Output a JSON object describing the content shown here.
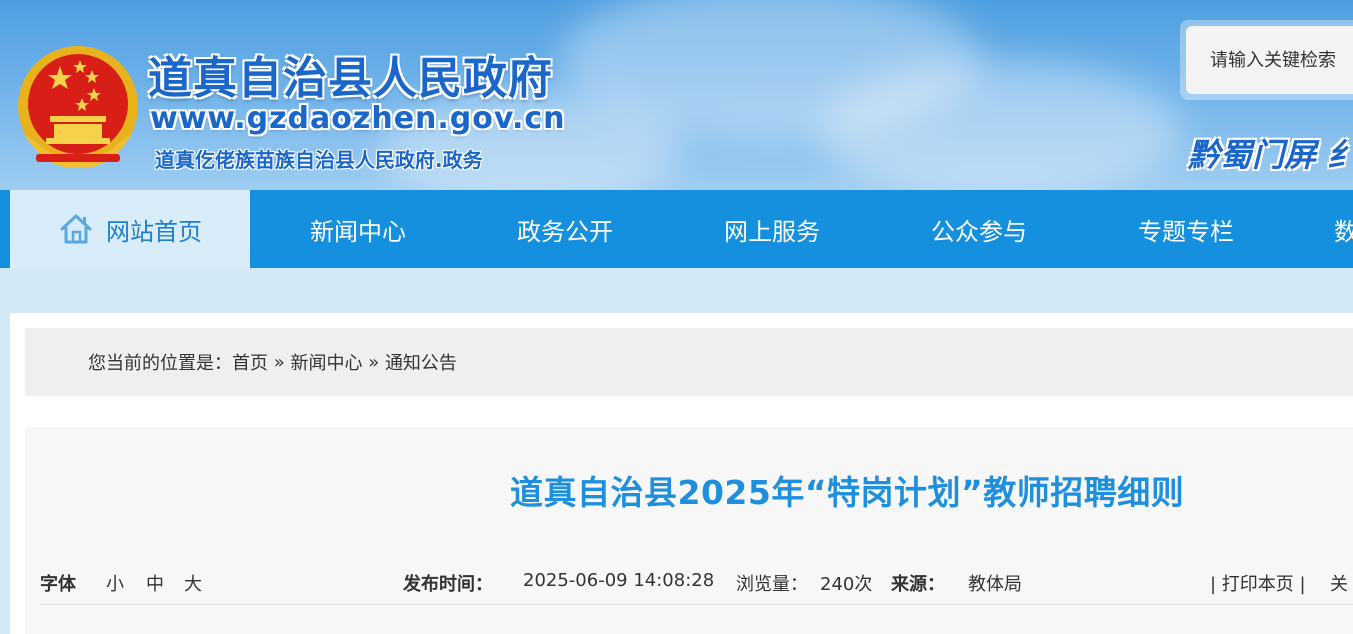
{
  "header": {
    "site_title": "道真自治县人民政府",
    "site_url": "www.gzdaozhen.gov.cn",
    "site_subtitle": "道真仡佬族苗族自治县人民政府.政务",
    "search_placeholder": "请输入关键检索",
    "portal_link": "黔蜀门屏 纟",
    "emblem": "national-emblem-icon"
  },
  "nav": {
    "items": [
      {
        "label": "网站首页",
        "active": true
      },
      {
        "label": "新闻中心"
      },
      {
        "label": "政务公开"
      },
      {
        "label": "网上服务"
      },
      {
        "label": "公众参与"
      },
      {
        "label": "专题专栏"
      },
      {
        "label": "数"
      }
    ]
  },
  "breadcrumb": {
    "prefix": "您当前的位置是：",
    "items": [
      "首页",
      "新闻中心",
      "通知公告"
    ],
    "separator": " » "
  },
  "article": {
    "title": "道真自治县2025年“特岗计划”教师招聘细则",
    "font_size_label": "字体",
    "font_sizes": [
      "小",
      "中",
      "大"
    ],
    "publish_label": "发布时间：",
    "publish_time": "2025-06-09 14:08:28",
    "views_label": "浏览量：",
    "views_value": "240次",
    "source_label": "来源：",
    "source_value": "教体局",
    "print_label": "| 打印本页 |",
    "close_label": "关"
  },
  "colors": {
    "nav_bg": "#1590df",
    "title_blue": "#1d8fdc",
    "header_text": "#1a66c9"
  }
}
